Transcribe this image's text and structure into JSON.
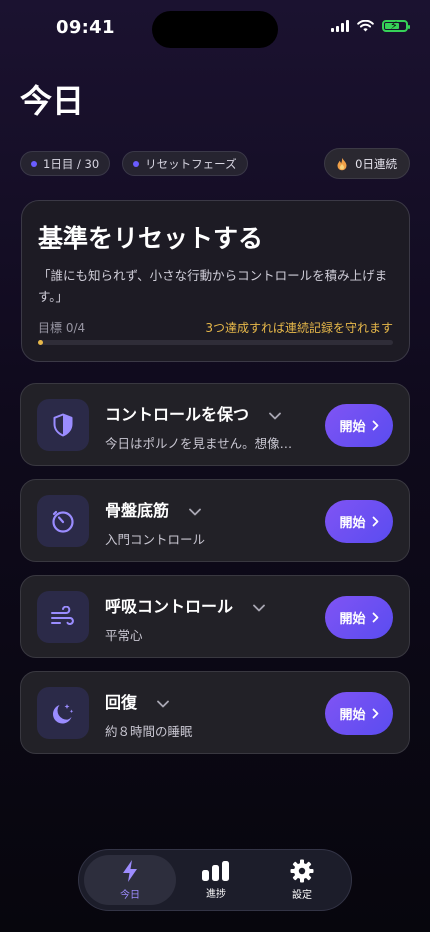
{
  "status_bar": {
    "time": "09:41"
  },
  "header": {
    "title": "今日"
  },
  "chips": [
    {
      "label": "1日目 / 30"
    },
    {
      "label": "リセットフェーズ"
    }
  ],
  "streak": {
    "label": "0日連続"
  },
  "hero": {
    "title": "基準をリセットする",
    "quote": "「誰にも知られず、小さな行動からコントロールを積み上げます。」",
    "goal_label": "目標 0/4",
    "goal_hint": "3つ達成すれば連続記録を守れます",
    "progress": 0
  },
  "tasks": [
    {
      "title": "コントロールを保つ",
      "subtitle": "今日はポルノを見ません。想像…",
      "button": "開始",
      "icon": "shield-icon"
    },
    {
      "title": "骨盤底筋",
      "subtitle": "入門コントロール",
      "button": "開始",
      "icon": "timer-icon"
    },
    {
      "title": "呼吸コントロール",
      "subtitle": "平常心",
      "button": "開始",
      "icon": "wind-icon"
    },
    {
      "title": "回復",
      "subtitle": "約８時間の睡眠",
      "button": "開始",
      "icon": "moon-stars-icon"
    }
  ],
  "tab_bar": {
    "tabs": [
      {
        "label": "今日",
        "icon": "bolt-icon",
        "active": true
      },
      {
        "label": "進捗",
        "icon": "bar-chart-icon",
        "active": false
      },
      {
        "label": "設定",
        "icon": "gear-icon",
        "active": false
      }
    ]
  },
  "colors": {
    "accent": "#6a5cff",
    "gold": "#e7b84a",
    "button": "#6f50f2",
    "battery": "#36d158"
  }
}
